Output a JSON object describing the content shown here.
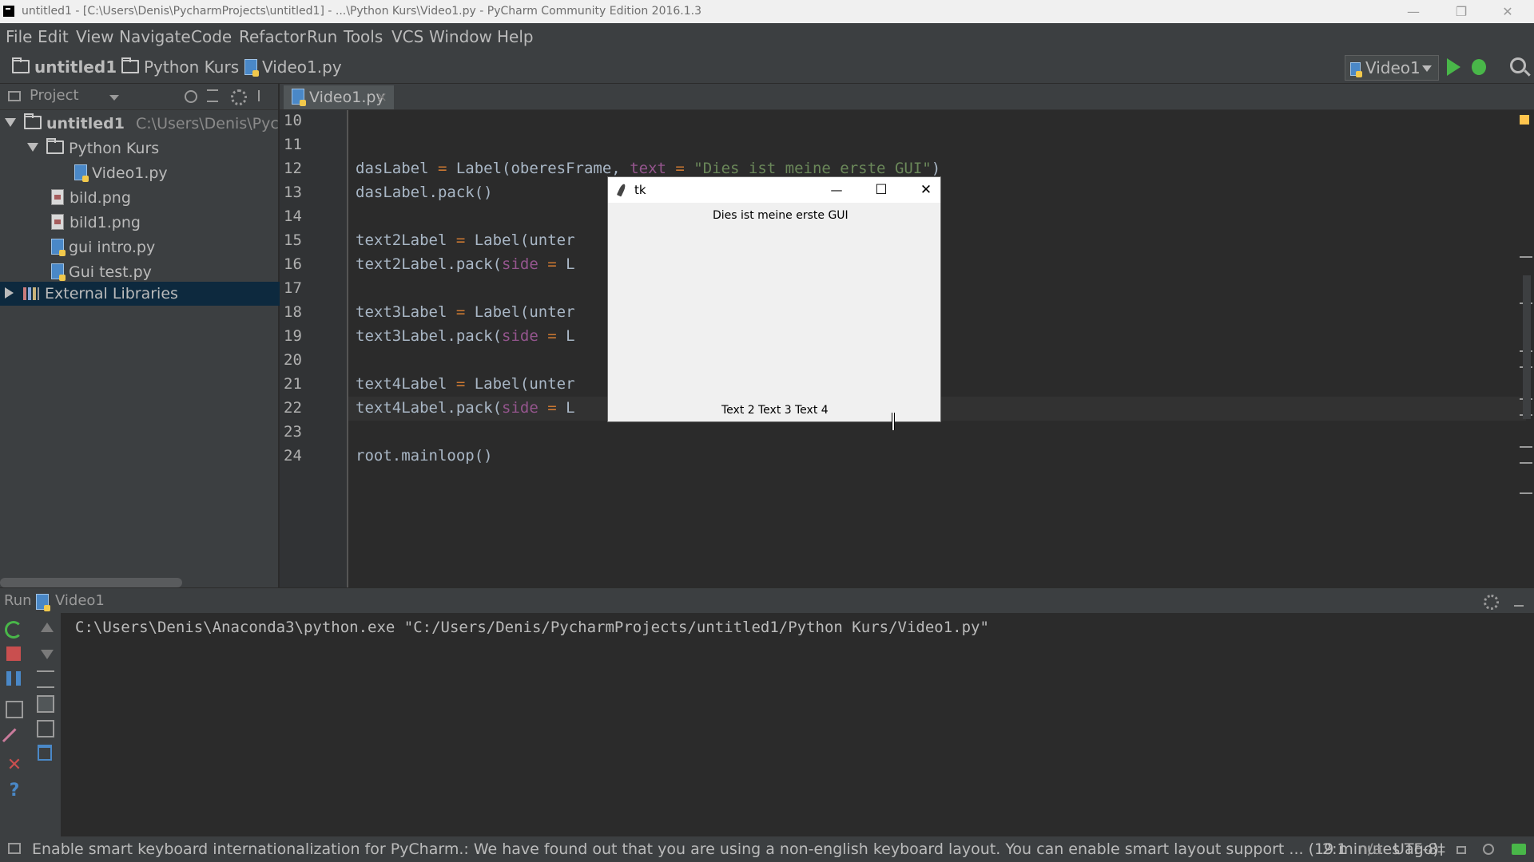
{
  "window": {
    "title": "untitled1 - [C:\\Users\\Denis\\PycharmProjects\\untitled1] - ...\\Python Kurs\\Video1.py - PyCharm Community Edition 2016.1.3",
    "minimize": "—",
    "restore": "❐",
    "close": "✕"
  },
  "menu": [
    "File",
    "Edit",
    "View",
    "Navigate",
    "Code",
    "Refactor",
    "Run",
    "Tools",
    "VCS",
    "Window",
    "Help"
  ],
  "breadcrumb": [
    "untitled1",
    "Python Kurs",
    "Video1.py"
  ],
  "run_config": "Video1",
  "project_panel": {
    "title": "Project",
    "tree": [
      {
        "label": "untitled1",
        "path": "C:\\Users\\Denis\\Pychar"
      },
      {
        "label": "Python Kurs"
      },
      {
        "label": "Video1.py"
      },
      {
        "label": "bild.png"
      },
      {
        "label": "bild1.png"
      },
      {
        "label": "gui intro.py"
      },
      {
        "label": "Gui test.py"
      },
      {
        "label": "External Libraries"
      }
    ]
  },
  "editor": {
    "tab": "Video1.py",
    "tab_close": "×",
    "line_numbers": [
      "10",
      "11",
      "12",
      "13",
      "14",
      "15",
      "16",
      "17",
      "18",
      "19",
      "20",
      "21",
      "22",
      "23",
      "24"
    ],
    "code": {
      "l12_a": "dasLabel",
      "l12_b": " = ",
      "l12_c": "Label(oberesFrame, ",
      "l12_d": "text",
      "l12_e": " = ",
      "l12_f": "\"Dies ist meine erste GUI\"",
      "l12_g": ")",
      "l13": "dasLabel.pack()",
      "l15_a": "text2Label",
      "l15_b": " = ",
      "l15_c": "Label(unter",
      "l16_a": "text2Label.pack(",
      "l16_b": "side",
      "l16_c": " = ",
      "l16_d": "L",
      "l18_a": "text3Label",
      "l18_b": " = ",
      "l18_c": "Label(unter",
      "l19_a": "text3Label.pack(",
      "l19_b": "side",
      "l19_c": " = ",
      "l19_d": "L",
      "l21_a": "text4Label",
      "l21_b": " = ",
      "l21_c": "Label(unter",
      "l22_a": "text4Label.pack(",
      "l22_b": "side",
      "l22_c": " = ",
      "l22_d": "L",
      "l24": "root.mainloop()"
    }
  },
  "tk_window": {
    "title": "tk",
    "minimize": "—",
    "maximize": "☐",
    "close": "✕",
    "top_label": "Dies ist meine erste GUI",
    "bottom_labels": [
      "Text 2",
      "Text 3",
      "Text 4"
    ]
  },
  "run_panel": {
    "label": "Run",
    "config": "Video1",
    "command": "C:\\Users\\Denis\\Anaconda3\\python.exe \"C:/Users/Denis/PycharmProjects/untitled1/Python Kurs/Video1.py\""
  },
  "status": {
    "message": "Enable smart keyboard internationalization for PyCharm.: We have found out that you are using a non-english keyboard layout. You can enable smart layout support ... (19 minutes ago)",
    "position": "2:1",
    "na": "n/a",
    "encoding": "UTF-8‡"
  },
  "colors": {
    "editor_bg": "#2b2b2b",
    "panel_bg": "#3c3f41",
    "selection": "#0d293e",
    "keyword": "#cc7832",
    "string": "#6a8759",
    "param": "#94558d",
    "run_green": "#49b749",
    "stop_red": "#c94f4f"
  }
}
